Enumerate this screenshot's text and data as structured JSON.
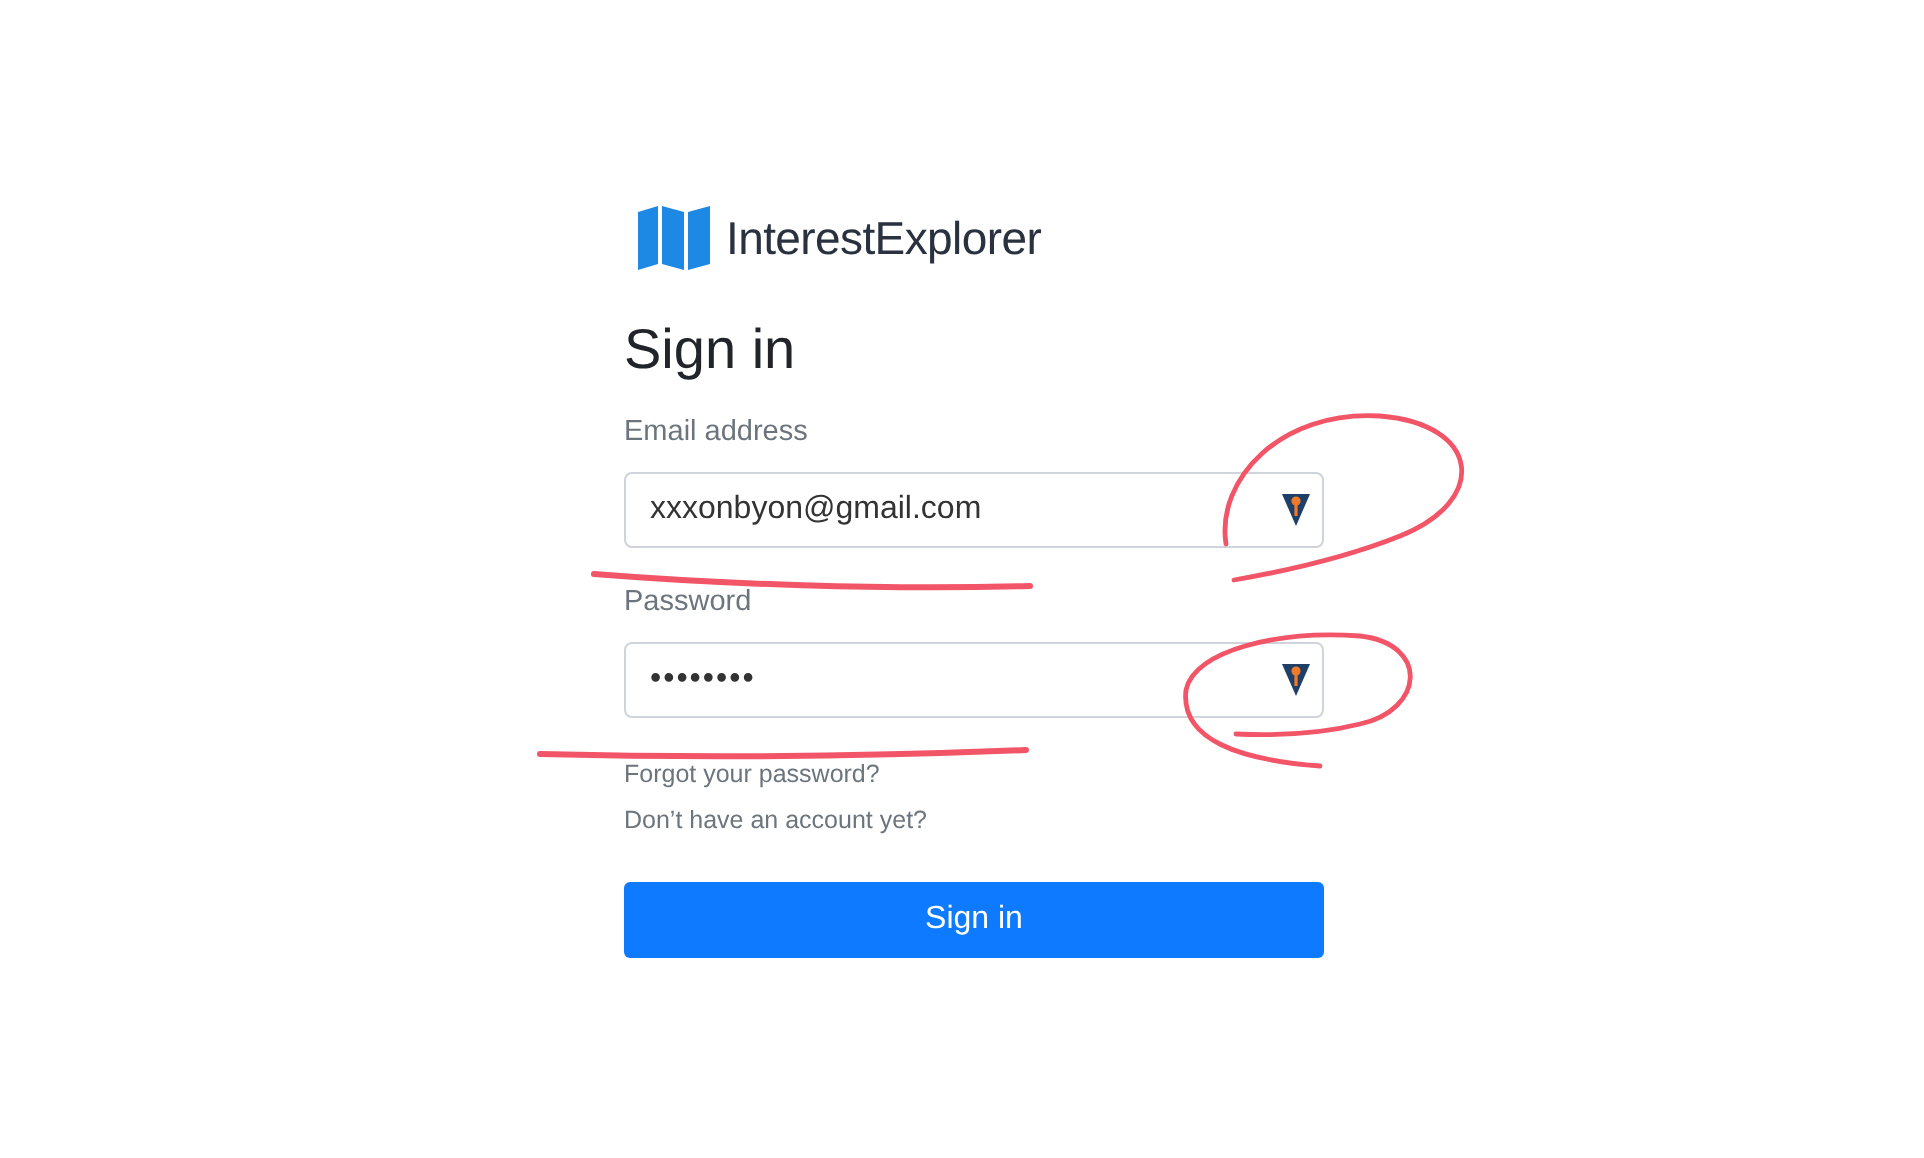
{
  "brand": {
    "name": "InterestExplorer"
  },
  "title": "Sign in",
  "fields": [
    {
      "label": "Email address",
      "value": "xxxonbyon@gmail.com",
      "kind": "text"
    },
    {
      "label": "Password",
      "value": "••••••••",
      "kind": "password"
    }
  ],
  "links": [
    "Forgot your password?",
    "Don’t have an account yet?"
  ],
  "submit": "Sign in",
  "annotations": [
    {
      "kind": "underline"
    },
    {
      "kind": "loop"
    },
    {
      "kind": "underline"
    },
    {
      "kind": "loop"
    }
  ]
}
